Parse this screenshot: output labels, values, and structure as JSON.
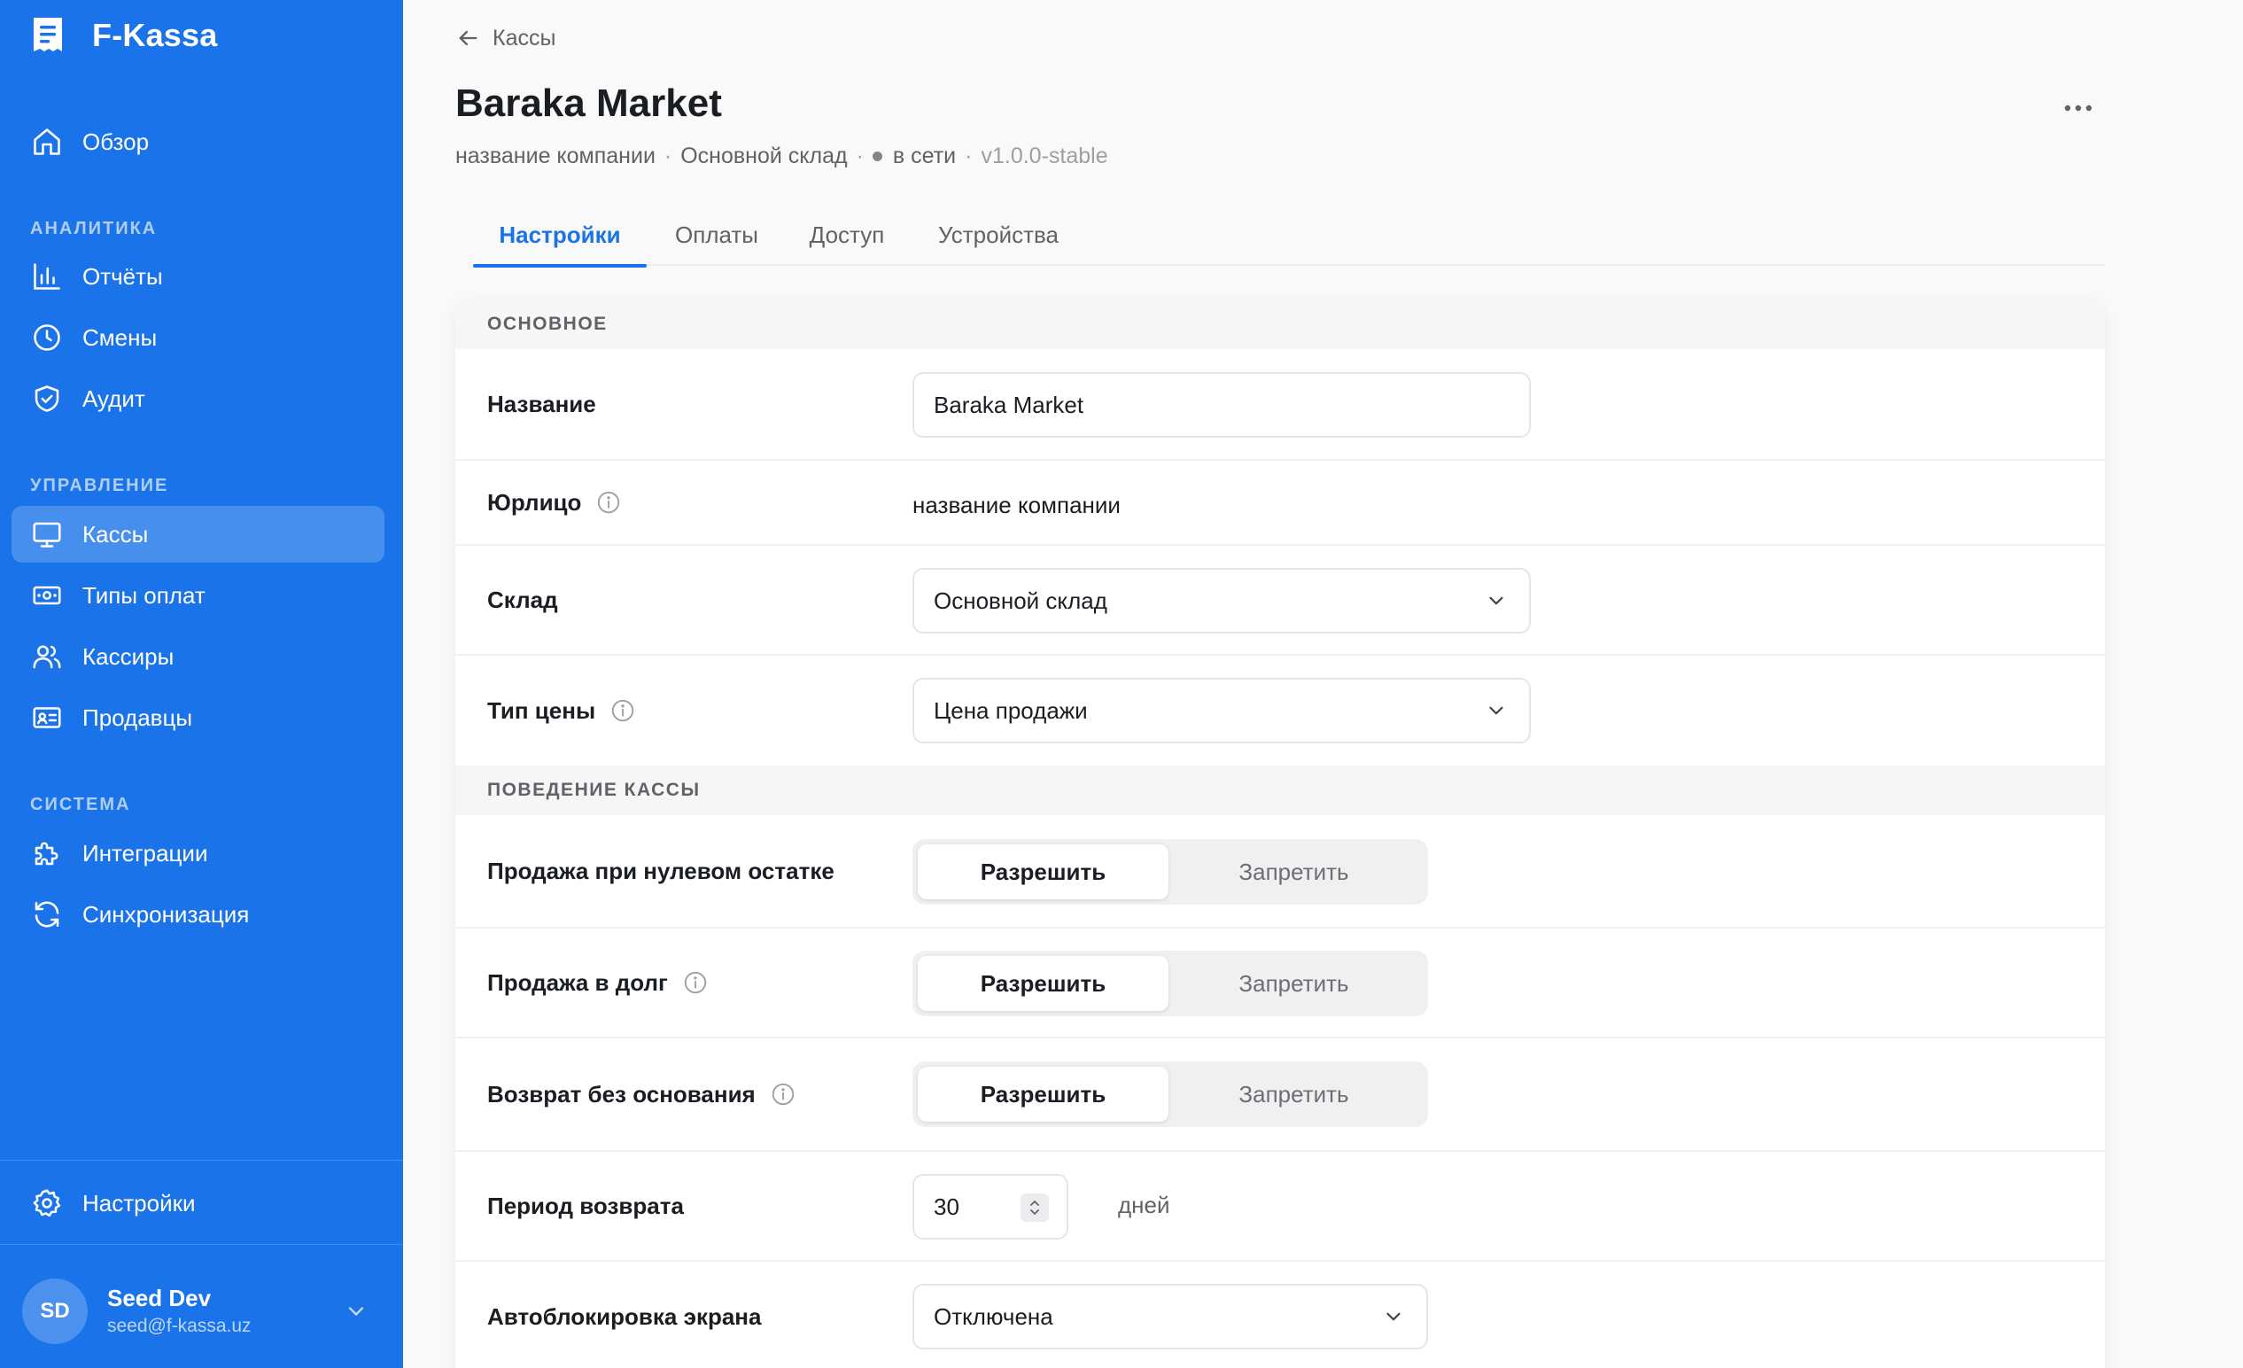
{
  "app": {
    "name": "F-Kassa"
  },
  "sidebar": {
    "overview": {
      "label": "Обзор",
      "icon": "home-icon"
    },
    "sections": [
      {
        "title": "АНАЛИТИКА",
        "items": [
          {
            "label": "Отчёты",
            "icon": "bar-chart-icon"
          },
          {
            "label": "Смены",
            "icon": "clock-icon"
          },
          {
            "label": "Аудит",
            "icon": "shield-check-icon"
          }
        ]
      },
      {
        "title": "УПРАВЛЕНИЕ",
        "items": [
          {
            "label": "Кассы",
            "icon": "monitor-icon",
            "active": true
          },
          {
            "label": "Типы оплат",
            "icon": "banknote-icon"
          },
          {
            "label": "Кассиры",
            "icon": "users-icon"
          },
          {
            "label": "Продавцы",
            "icon": "id-card-icon"
          }
        ]
      },
      {
        "title": "СИСТЕМА",
        "items": [
          {
            "label": "Интеграции",
            "icon": "puzzle-icon"
          },
          {
            "label": "Синхронизация",
            "icon": "refresh-icon"
          }
        ]
      }
    ],
    "settings": {
      "label": "Настройки",
      "icon": "gear-icon"
    },
    "user": {
      "initials": "SD",
      "name": "Seed Dev",
      "email": "seed@f-kassa.uz"
    }
  },
  "header": {
    "back_label": "Кассы",
    "title": "Baraka Market",
    "subtitle": {
      "company": "название компании",
      "warehouse": "Основной склад",
      "status": "в сети",
      "version": "v1.0.0-stable"
    }
  },
  "tabs": [
    {
      "label": "Настройки",
      "active": true
    },
    {
      "label": "Оплаты",
      "active": false
    },
    {
      "label": "Доступ",
      "active": false
    },
    {
      "label": "Устройства",
      "active": false
    }
  ],
  "form": {
    "section_main": "ОСНОВНОЕ",
    "name": {
      "label": "Название",
      "value": "Baraka Market"
    },
    "legal": {
      "label": "Юрлицо",
      "value": "название компании"
    },
    "warehouse": {
      "label": "Склад",
      "value": "Основной склад"
    },
    "price_type": {
      "label": "Тип цены",
      "value": "Цена продажи"
    },
    "section_behavior": "ПОВЕДЕНИЕ КАССЫ",
    "zero_stock": {
      "label": "Продажа при нулевом остатке",
      "options": [
        "Разрешить",
        "Запретить"
      ],
      "selected": "Разрешить"
    },
    "debt_sale": {
      "label": "Продажа в долг",
      "options": [
        "Разрешить",
        "Запретить"
      ],
      "selected": "Разрешить"
    },
    "return_no_reason": {
      "label": "Возврат без основания",
      "options": [
        "Разрешить",
        "Запретить"
      ],
      "selected": "Разрешить"
    },
    "return_period": {
      "label": "Период возврата",
      "value": "30",
      "unit": "дней"
    },
    "autolock": {
      "label": "Автоблокировка экрана",
      "value": "Отключена"
    }
  },
  "colors": {
    "accent": "#1a73e8",
    "sidebar_bg": "#1a73e8",
    "page_bg": "#f9f9f9"
  }
}
